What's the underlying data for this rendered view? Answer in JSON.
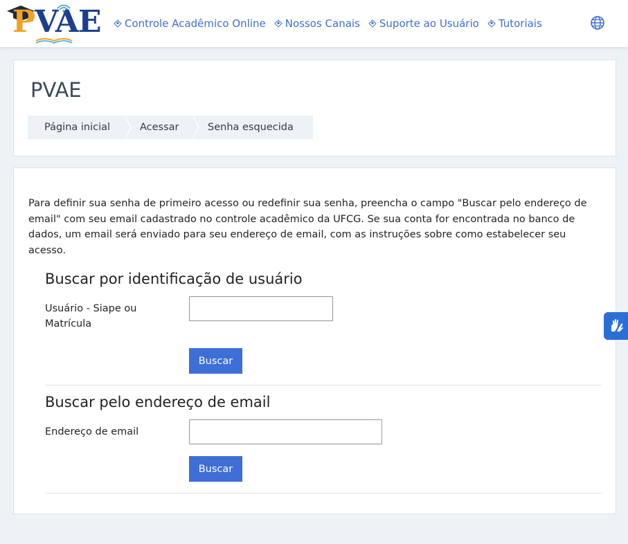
{
  "logo": {
    "text_p": "P",
    "text_vae": "VAE",
    "name": "PVAE logo"
  },
  "nav": {
    "links": [
      {
        "label": "Controle Acadêmico Online"
      },
      {
        "label": "Nossos Canais"
      },
      {
        "label": "Suporte ao Usuário"
      },
      {
        "label": "Tutoriais"
      }
    ],
    "language_icon": "globe-icon"
  },
  "header": {
    "title": "PVAE",
    "breadcrumb": [
      "Página inicial",
      "Acessar",
      "Senha esquecida"
    ]
  },
  "main": {
    "intro": "Para definir sua senha de primeiro acesso ou redefinir sua senha, preencha o campo \"Buscar pelo endereço de email\" com seu email cadastrado no controle acadêmico da UFCG. Se sua conta for encontrada no banco de dados, um email será enviado para seu endereço de email, com as instruções sobre como estabelecer seu acesso.",
    "by_username": {
      "title": "Buscar por identificação de usuário",
      "label": "Usuário - Siape ou Matrícula",
      "value": "",
      "button": "Buscar"
    },
    "by_email": {
      "title": "Buscar pelo endereço de email",
      "label": "Endereço de email",
      "value": "",
      "button": "Buscar"
    }
  },
  "accessibility": {
    "icon": "sign-language-hands-icon"
  },
  "colors": {
    "accent": "#3e6fd6",
    "background": "#edf2f6",
    "widget": "#2b6fd6",
    "logo_orange": "#f4a11f",
    "logo_navy": "#1b3f8e"
  }
}
